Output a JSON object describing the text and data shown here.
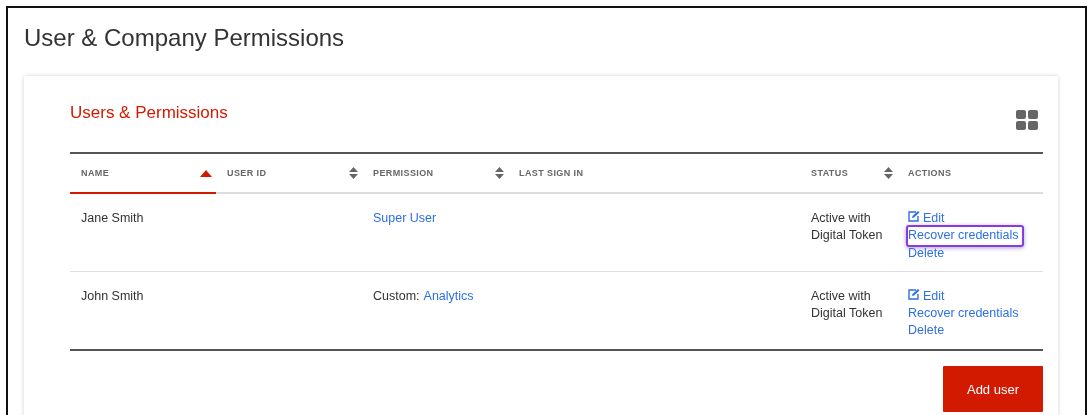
{
  "page_title": "User & Company Permissions",
  "card": {
    "title": "Users & Permissions"
  },
  "table": {
    "columns": [
      {
        "label": "NAME",
        "sortable": true,
        "sorted": true
      },
      {
        "label": "USER ID",
        "sortable": true,
        "sorted": false
      },
      {
        "label": "PERMISSION",
        "sortable": true,
        "sorted": false
      },
      {
        "label": "LAST SIGN IN",
        "sortable": false,
        "sorted": false
      },
      {
        "label": "STATUS",
        "sortable": true,
        "sorted": false
      },
      {
        "label": "ACTIONS",
        "sortable": false,
        "sorted": false
      }
    ],
    "rows": [
      {
        "name": "Jane Smith",
        "permission": {
          "link": "Super User"
        },
        "status": "Active with Digital Token",
        "actions": [
          {
            "kind": "edit",
            "label": "Edit",
            "highlighted": false
          },
          {
            "kind": "link",
            "label": "Recover credentials",
            "highlighted": true
          },
          {
            "kind": "link",
            "label": "Delete",
            "highlighted": false
          }
        ]
      },
      {
        "name": "John Smith",
        "permission": {
          "prefix": "Custom:",
          "link": "Analytics"
        },
        "status": "Active with Digital Token",
        "actions": [
          {
            "kind": "edit",
            "label": "Edit",
            "highlighted": false
          },
          {
            "kind": "link",
            "label": "Recover credentials",
            "highlighted": false
          },
          {
            "kind": "link",
            "label": "Delete",
            "highlighted": false
          }
        ]
      }
    ]
  },
  "add_button": "Add user"
}
